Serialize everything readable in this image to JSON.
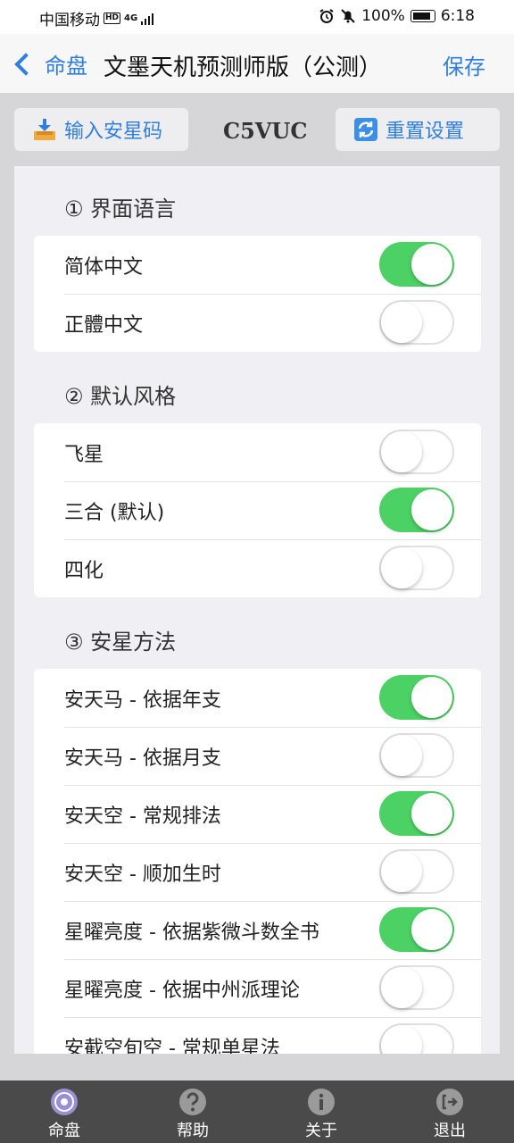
{
  "status": {
    "carrier": "中国移动",
    "hd": "HD",
    "network": "4G",
    "battery_pct": "100%",
    "time": "6:18"
  },
  "nav": {
    "back_label": "命盘",
    "title": "文墨天机预测师版（公测）",
    "save_label": "保存"
  },
  "toolbar": {
    "import_label": "输入安星码",
    "code": "C5VUC",
    "reset_label": "重置设置"
  },
  "sections": [
    {
      "title": "① 界面语言",
      "items": [
        {
          "label": "简体中文",
          "on": true
        },
        {
          "label": "正體中文",
          "on": false
        }
      ]
    },
    {
      "title": "② 默认风格",
      "items": [
        {
          "label": "飞星",
          "on": false
        },
        {
          "label": "三合 (默认)",
          "on": true
        },
        {
          "label": "四化",
          "on": false
        }
      ]
    },
    {
      "title": "③ 安星方法",
      "items": [
        {
          "label": "安天马 - 依据年支",
          "on": true
        },
        {
          "label": "安天马 - 依据月支",
          "on": false
        },
        {
          "label": "安天空 - 常规排法",
          "on": true
        },
        {
          "label": "安天空 - 顺加生时",
          "on": false
        },
        {
          "label": "星曜亮度 - 依据紫微斗数全书",
          "on": true
        },
        {
          "label": "星曜亮度 - 依据中州派理论",
          "on": false
        },
        {
          "label": "安截空旬空 - 常规单星法",
          "on": false
        }
      ]
    }
  ],
  "tabs": [
    {
      "label": "命盘",
      "icon": "chart-disc-icon",
      "active": true
    },
    {
      "label": "帮助",
      "icon": "help-icon",
      "active": false
    },
    {
      "label": "关于",
      "icon": "info-icon",
      "active": false
    },
    {
      "label": "退出",
      "icon": "exit-icon",
      "active": false
    }
  ],
  "colors": {
    "accent": "#2f7ee0",
    "toggle_on": "#4cd264",
    "tabbar": "#4a4a4a"
  }
}
